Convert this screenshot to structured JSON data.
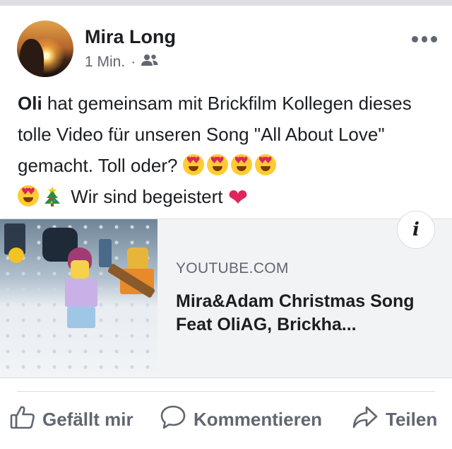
{
  "post": {
    "author": "Mira Long",
    "time": "1 Min.",
    "separator": "·",
    "audience_icon": "friends-icon",
    "text": {
      "mention": "Oli",
      "body": " hat gemeinsam mit Brickfilm Kollegen dieses tolle Video für unseren Song \"All About Love\" gemacht. Toll oder? ",
      "tail": " Wir sind begeistert "
    }
  },
  "link_preview": {
    "domain": "YOUTUBE.COM",
    "title": "Mira&Adam Christmas Song Feat OliAG, Brickha...",
    "info_label": "i"
  },
  "actions": {
    "like": "Gefällt mir",
    "comment": "Kommentieren",
    "share": "Teilen"
  },
  "colors": {
    "text": "#1c1e21",
    "secondary": "#606770",
    "card_bg": "#f2f3f5",
    "heart": "#e0245e"
  }
}
